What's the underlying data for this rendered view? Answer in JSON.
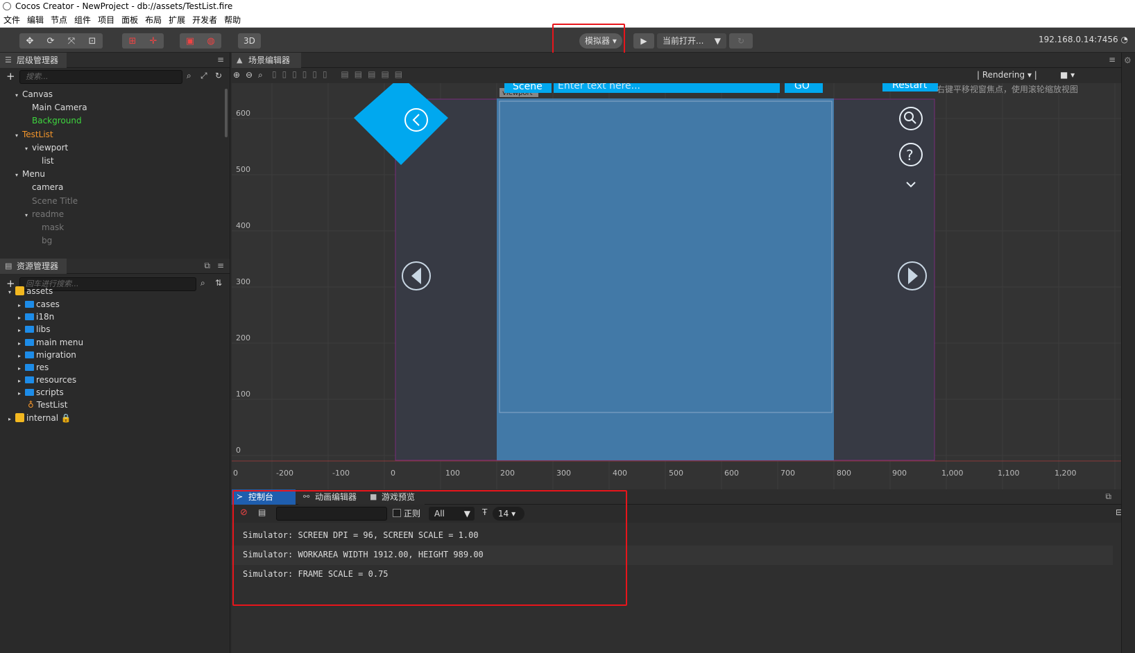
{
  "window": {
    "title": "Cocos Creator - NewProject - db://assets/TestList.fire"
  },
  "menu": [
    "文件",
    "编辑",
    "节点",
    "组件",
    "项目",
    "面板",
    "布局",
    "扩展",
    "开发者",
    "帮助"
  ],
  "toolbar": {
    "btn_3d": "3D",
    "platform": "模拟器 ▾",
    "scene_select": "当前打开...",
    "ip": "192.168.0.14:7456"
  },
  "hierarchy": {
    "title": "层级管理器",
    "search_placeholder": "搜索...",
    "nodes": [
      {
        "label": "Canvas",
        "depth": 0,
        "state": "normal",
        "caret": "▾"
      },
      {
        "label": "Main Camera",
        "depth": 1,
        "state": "normal",
        "caret": ""
      },
      {
        "label": "Background",
        "depth": 1,
        "state": "green",
        "caret": ""
      },
      {
        "label": "TestList",
        "depth": 0,
        "state": "orange",
        "caret": "▾"
      },
      {
        "label": "viewport",
        "depth": 1,
        "state": "normal",
        "caret": "▾"
      },
      {
        "label": "list",
        "depth": 2,
        "state": "normal",
        "caret": ""
      },
      {
        "label": "Menu",
        "depth": 0,
        "state": "normal",
        "caret": "▾"
      },
      {
        "label": "camera",
        "depth": 1,
        "state": "normal",
        "caret": ""
      },
      {
        "label": "Scene Title",
        "depth": 1,
        "state": "dim",
        "caret": ""
      },
      {
        "label": "readme",
        "depth": 1,
        "state": "dim",
        "caret": "▾"
      },
      {
        "label": "mask",
        "depth": 2,
        "state": "dim",
        "caret": ""
      },
      {
        "label": "bg",
        "depth": 2,
        "state": "dim",
        "caret": ""
      }
    ]
  },
  "assets": {
    "title": "资源管理器",
    "search_placeholder": "回车进行搜索...",
    "root": "assets",
    "folders": [
      "cases",
      "i18n",
      "libs",
      "main menu",
      "migration",
      "res",
      "resources",
      "scripts"
    ],
    "scene_file": "TestList",
    "internal": "internal"
  },
  "scene": {
    "tab": "场景编辑器",
    "rendering": "Rendering",
    "hint": "右键平移视窗焦点，使用滚轮缩放视图",
    "viewport_label": "viewport",
    "scene_btn": "Scene",
    "input_placeholder": "Enter text here...",
    "go_btn": "GO",
    "restart_btn": "Restart",
    "y_labels": [
      "600",
      "500",
      "400",
      "300",
      "200",
      "100",
      "0"
    ],
    "x_labels": [
      "0",
      "-200",
      "-100",
      "0",
      "100",
      "200",
      "300",
      "400",
      "500",
      "600",
      "700",
      "800",
      "900",
      "1,000",
      "1,100",
      "1,200"
    ]
  },
  "console": {
    "tabs": [
      "控制台",
      "动画编辑器",
      "游戏预览"
    ],
    "regex_label": "正则",
    "filter": "All",
    "font_size": "14",
    "lines": [
      "Simulator: SCREEN DPI = 96, SCREEN SCALE = 1.00",
      "Simulator: WORKAREA WIDTH 1912.00, HEIGHT 989.00",
      "Simulator: FRAME SCALE = 0.75"
    ]
  },
  "colors": {
    "accent": "#e8151b",
    "node_active": "#3ed63e",
    "node_prefab": "#f5962a",
    "scene_blue": "#4279a7",
    "ui_blue": "#00a8ef"
  }
}
